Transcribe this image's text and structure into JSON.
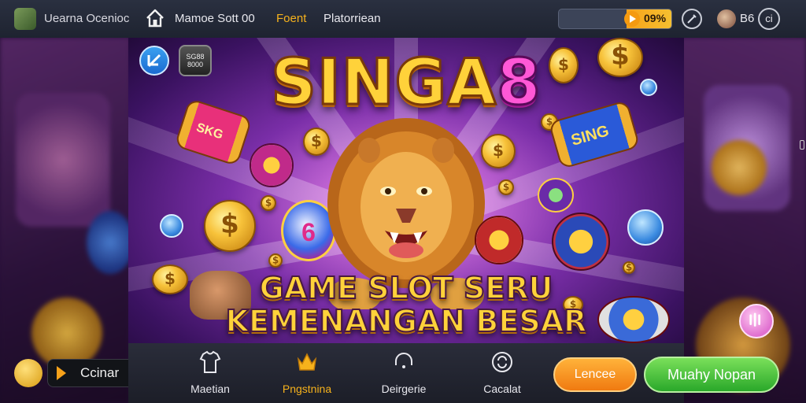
{
  "topbar": {
    "app_name": "Uearna Ocenioc",
    "nav": [
      "Mamoe Sott 00",
      "Foent",
      "Platorriean"
    ],
    "active_nav_index": 1,
    "progress": {
      "percent_text": "09%",
      "fill_fraction": 0.4
    },
    "user_text": "B6",
    "badge_text": "ci"
  },
  "banner": {
    "logo_main": "SINGA",
    "logo_accent": "8",
    "badge_text": "SG88\n8000",
    "tagline_line1": "GAME SLOT SERU",
    "tagline_line2": "KEMENANGAN BESAR",
    "can_left_text": "SKG",
    "can_right_text": "SING",
    "coin_center_text": "6"
  },
  "bottombar": {
    "tabs": [
      {
        "label": "Maetian",
        "icon": "shirt-icon"
      },
      {
        "label": "Pngstnina",
        "icon": "crown-icon"
      },
      {
        "label": "Deirgerie",
        "icon": "headset-icon"
      },
      {
        "label": "Cacalat",
        "icon": "refresh-icon"
      }
    ],
    "active_tab_index": 1,
    "orange_button": "Lencee",
    "green_button": "Muahy Nopan",
    "play_label": "Ccinar"
  },
  "colors": {
    "accent": "#f6b21c",
    "gold": "#ffd23a",
    "logo_pink": "#ff58d6",
    "green_button": "#2aa82a",
    "orange_button": "#f07a10"
  }
}
